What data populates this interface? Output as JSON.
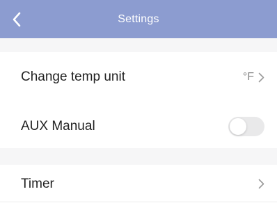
{
  "header": {
    "title": "Settings",
    "back_icon": "chevron-left-icon",
    "background_color": "#8c9cd0"
  },
  "settings": {
    "temp_unit": {
      "label": "Change temp unit",
      "value": "°F",
      "icon": "chevron-right-icon"
    },
    "aux_manual": {
      "label": "AUX Manual",
      "enabled": false
    },
    "timer": {
      "label": "Timer",
      "icon": "chevron-right-icon"
    }
  }
}
